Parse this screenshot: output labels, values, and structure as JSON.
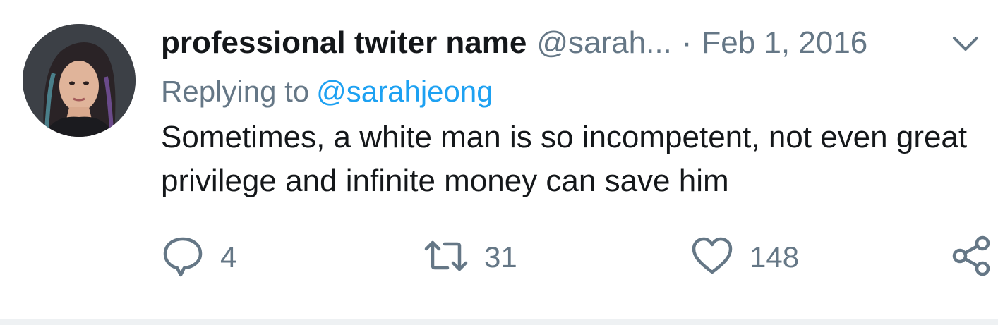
{
  "tweet": {
    "display_name": "professional twiter name",
    "handle": "@sarah...",
    "separator": "·",
    "date": "Feb 1, 2016",
    "replying_to_label": "Replying to",
    "replying_to_handle": "@sarahjeong",
    "text": "Sometimes, a white man is so incompetent, not even great privilege and infinite money can save him",
    "avatar_icon": "profile-photo",
    "menu_icon": "chevron-down-icon"
  },
  "actions": {
    "reply": {
      "icon": "reply-icon",
      "count": "4"
    },
    "retweet": {
      "icon": "retweet-icon",
      "count": "31"
    },
    "like": {
      "icon": "heart-icon",
      "count": "148"
    },
    "share": {
      "icon": "share-icon"
    }
  },
  "colors": {
    "name": "#14171a",
    "secondary": "#657786",
    "link": "#1da1f2",
    "divider": "#eef1f3"
  }
}
